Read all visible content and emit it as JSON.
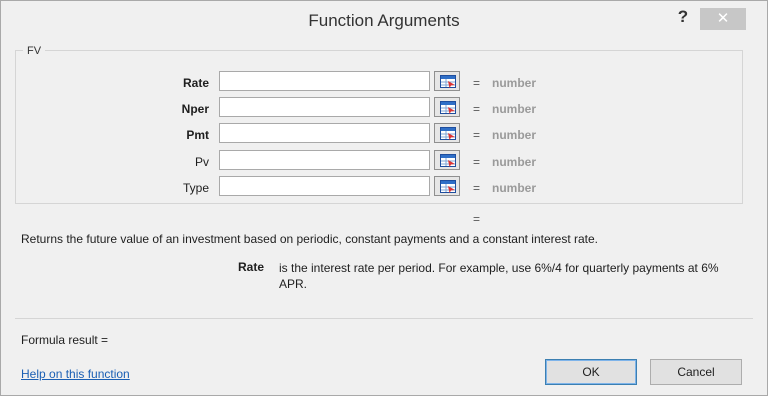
{
  "dialog": {
    "title": "Function Arguments",
    "help_glyph": "?",
    "close_glyph": "✕"
  },
  "function_name": "FV",
  "arguments": [
    {
      "label": "Rate",
      "bold": true,
      "value": "",
      "eq": "=",
      "type": "number"
    },
    {
      "label": "Nper",
      "bold": true,
      "value": "",
      "eq": "=",
      "type": "number"
    },
    {
      "label": "Pmt",
      "bold": true,
      "value": "",
      "eq": "=",
      "type": "number"
    },
    {
      "label": "Pv",
      "bold": false,
      "value": "",
      "eq": "=",
      "type": "number"
    },
    {
      "label": "Type",
      "bold": false,
      "value": "",
      "eq": "=",
      "type": "number"
    }
  ],
  "result_eq": "=",
  "description": "Returns the future value of an investment based on periodic, constant payments and a constant interest rate.",
  "arg_help": {
    "name": "Rate",
    "text": "is the interest rate per period. For example, use 6%/4 for quarterly payments at 6% APR."
  },
  "formula_result": "Formula result =",
  "help_link": "Help on this function",
  "buttons": {
    "ok": "OK",
    "cancel": "Cancel"
  },
  "icons": {
    "ref": "collapse-dialog-icon"
  },
  "colors": {
    "link": "#1a5fb4",
    "placeholder": "#9a9a9a"
  }
}
